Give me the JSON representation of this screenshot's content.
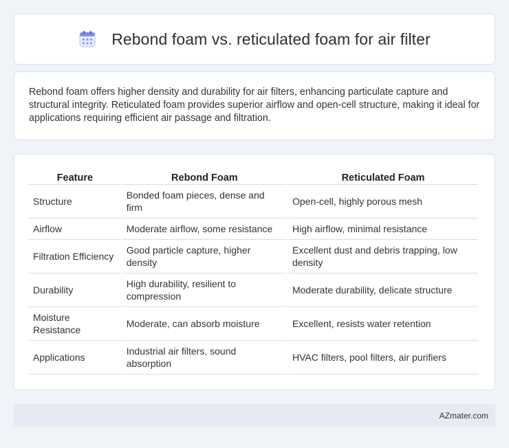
{
  "header": {
    "title": "Rebond foam vs. reticulated foam for air filter",
    "icon": "calendar-icon"
  },
  "summary": {
    "text": "Rebond foam offers higher density and durability for air filters, enhancing particulate capture and structural integrity. Reticulated foam provides superior airflow and open-cell structure, making it ideal for applications requiring efficient air passage and filtration."
  },
  "table": {
    "headers": [
      "Feature",
      "Rebond Foam",
      "Reticulated Foam"
    ],
    "rows": [
      [
        "Structure",
        "Bonded foam pieces, dense and firm",
        "Open-cell, highly porous mesh"
      ],
      [
        "Airflow",
        "Moderate airflow, some resistance",
        "High airflow, minimal resistance"
      ],
      [
        "Filtration Efficiency",
        "Good particle capture, higher density",
        "Excellent dust and debris trapping, low density"
      ],
      [
        "Durability",
        "High durability, resilient to compression",
        "Moderate durability, delicate structure"
      ],
      [
        "Moisture Resistance",
        "Moderate, can absorb moisture",
        "Excellent, resists water retention"
      ],
      [
        "Applications",
        "Industrial air filters, sound absorption",
        "HVAC filters, pool filters, air purifiers"
      ]
    ]
  },
  "footer": {
    "brand": "AZmater.com"
  },
  "colors": {
    "background": "#f0f3f8",
    "card": "#ffffff",
    "footer": "#e5eaf5",
    "icon_accent": "#6c7fe0"
  }
}
